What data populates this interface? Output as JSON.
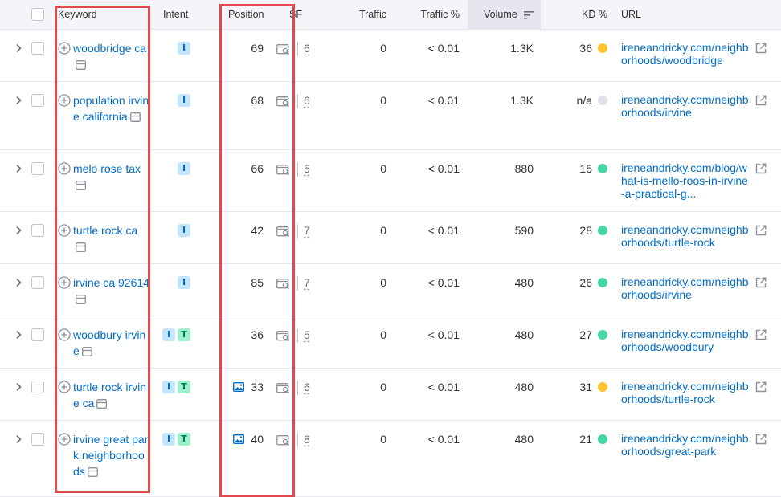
{
  "header": {
    "keyword": "Keyword",
    "intent": "Intent",
    "position": "Position",
    "sf": "SF",
    "traffic": "Traffic",
    "traffic_pct": "Traffic %",
    "volume": "Volume",
    "kd": "KD %",
    "url": "URL"
  },
  "colors": {
    "link": "#006dca",
    "kd_yellow": "#ffc42d",
    "kd_green": "#44d7a1",
    "kd_gray": "#dfe0e8",
    "highlight_box": "#e2484d"
  },
  "rows": [
    {
      "keyword": "woodbridge ca",
      "intents": [
        "I"
      ],
      "position": "69",
      "has_image": false,
      "sf": "6",
      "traffic": "0",
      "traffic_pct": "< 0.01",
      "volume": "1.3K",
      "kd": "36",
      "kd_color": "yellow",
      "url": "ireneandricky.com/neighborhoods/woodbridge"
    },
    {
      "keyword": "population irvine california",
      "intents": [
        "I"
      ],
      "position": "68",
      "has_image": false,
      "sf": "6",
      "traffic": "0",
      "traffic_pct": "< 0.01",
      "volume": "1.3K",
      "kd": "n/a",
      "kd_color": "gray",
      "url": "ireneandricky.com/neighborhoods/irvine"
    },
    {
      "keyword": "melo rose tax",
      "intents": [
        "I"
      ],
      "position": "66",
      "has_image": false,
      "sf": "5",
      "traffic": "0",
      "traffic_pct": "< 0.01",
      "volume": "880",
      "kd": "15",
      "kd_color": "green",
      "url": "ireneandricky.com/blog/what-is-mello-roos-in-irvine-a-practical-g..."
    },
    {
      "keyword": "turtle rock ca",
      "intents": [
        "I"
      ],
      "position": "42",
      "has_image": false,
      "sf": "7",
      "traffic": "0",
      "traffic_pct": "< 0.01",
      "volume": "590",
      "kd": "28",
      "kd_color": "green",
      "url": "ireneandricky.com/neighborhoods/turtle-rock"
    },
    {
      "keyword": "irvine ca 92614",
      "intents": [
        "I"
      ],
      "position": "85",
      "has_image": false,
      "sf": "7",
      "traffic": "0",
      "traffic_pct": "< 0.01",
      "volume": "480",
      "kd": "26",
      "kd_color": "green",
      "url": "ireneandricky.com/neighborhoods/irvine"
    },
    {
      "keyword": "woodbury irvine",
      "intents": [
        "I",
        "T"
      ],
      "position": "36",
      "has_image": false,
      "sf": "5",
      "traffic": "0",
      "traffic_pct": "< 0.01",
      "volume": "480",
      "kd": "27",
      "kd_color": "green",
      "url": "ireneandricky.com/neighborhoods/woodbury"
    },
    {
      "keyword": "turtle rock irvine ca",
      "intents": [
        "I",
        "T"
      ],
      "position": "33",
      "has_image": true,
      "sf": "6",
      "traffic": "0",
      "traffic_pct": "< 0.01",
      "volume": "480",
      "kd": "31",
      "kd_color": "yellow",
      "url": "ireneandricky.com/neighborhoods/turtle-rock"
    },
    {
      "keyword": "irvine great park neighborhoods",
      "intents": [
        "I",
        "T"
      ],
      "position": "40",
      "has_image": true,
      "sf": "8",
      "traffic": "0",
      "traffic_pct": "< 0.01",
      "volume": "480",
      "kd": "21",
      "kd_color": "green",
      "url": "ireneandricky.com/neighborhoods/great-park"
    }
  ]
}
